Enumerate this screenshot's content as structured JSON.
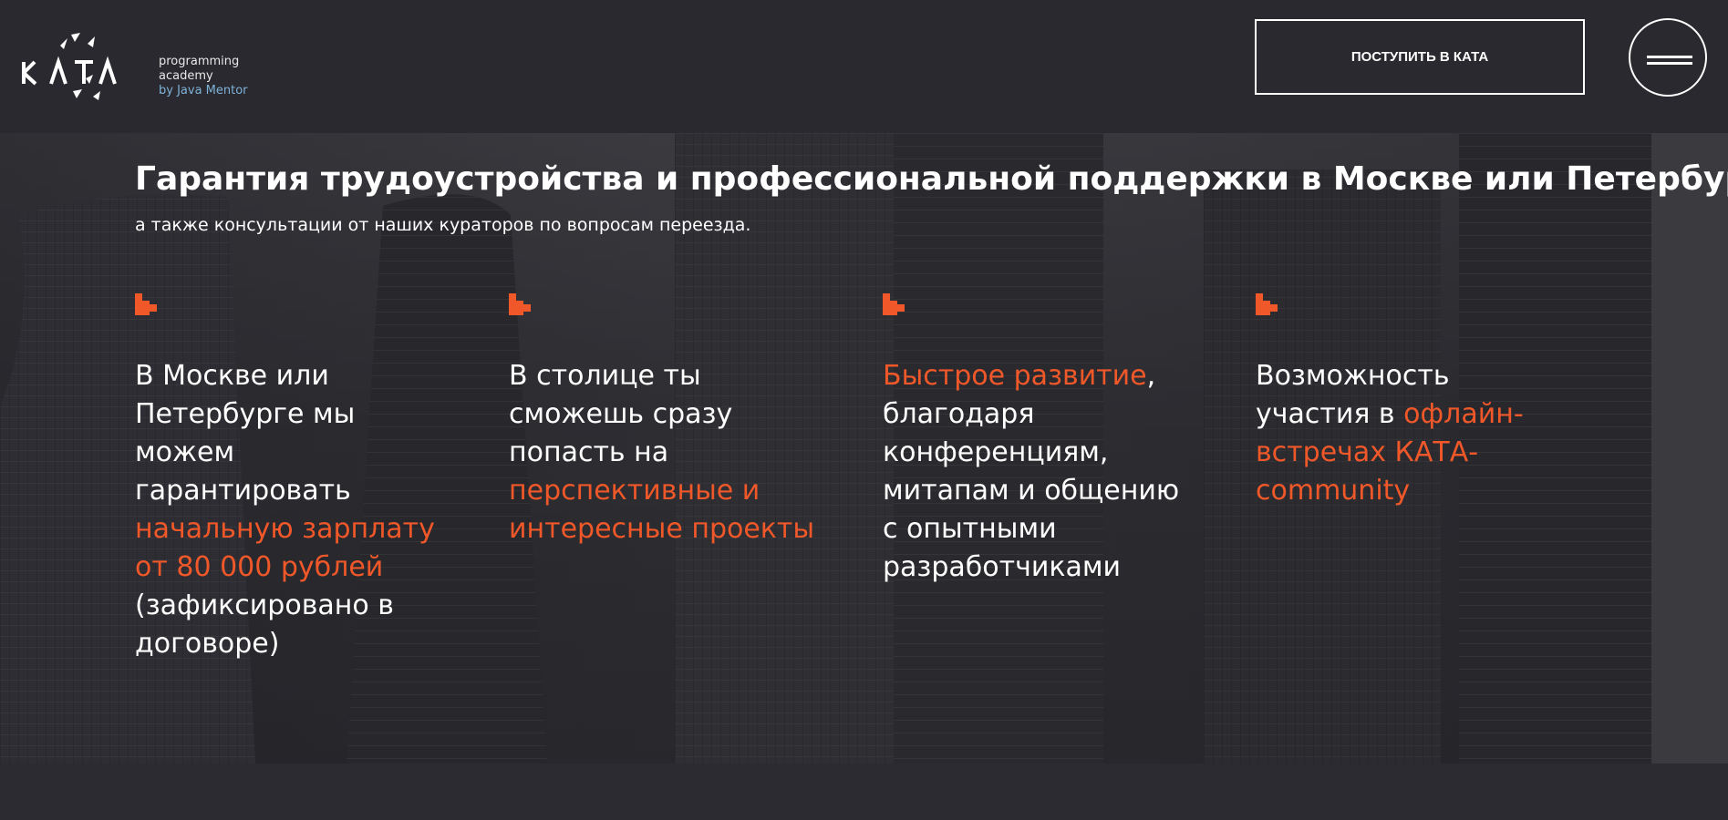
{
  "header": {
    "logo": {
      "wordmark": "KATA",
      "line1": "programming",
      "line2": "academy",
      "line3": "by Java Mentor"
    },
    "cta_label": "ПОСТУПИТЬ В КАТА",
    "menu_icon": "hamburger-icon"
  },
  "section": {
    "title": "Гарантия трудоустройства и профессиональной поддержки в Москве или Петербурге",
    "subtitle": "а также консультации от наших кураторов по вопросам переезда."
  },
  "features": [
    {
      "icon": "pixel-marker-icon",
      "before": "В Москве или Петербурге мы можем гарантировать ",
      "highlight": "начальную зарплату от 80 000 рублей",
      "after": " (зафиксировано в договоре)"
    },
    {
      "icon": "pixel-marker-icon",
      "before": "В столице ты сможешь сразу попасть на ",
      "highlight": "перспективные и интересные проекты",
      "after": ""
    },
    {
      "icon": "pixel-marker-icon",
      "before": "",
      "highlight": "Быстрое развитие",
      "after": ", благодаря конференциям, митапам и общению с опытными разработчиками"
    },
    {
      "icon": "pixel-marker-icon",
      "before": "Возможность участия в ",
      "highlight": "офлайн-встречах КАТА-community",
      "after": ""
    }
  ],
  "colors": {
    "accent": "#f0582a",
    "header_bg": "#29292f",
    "mentor_text": "#7fb2d8"
  }
}
